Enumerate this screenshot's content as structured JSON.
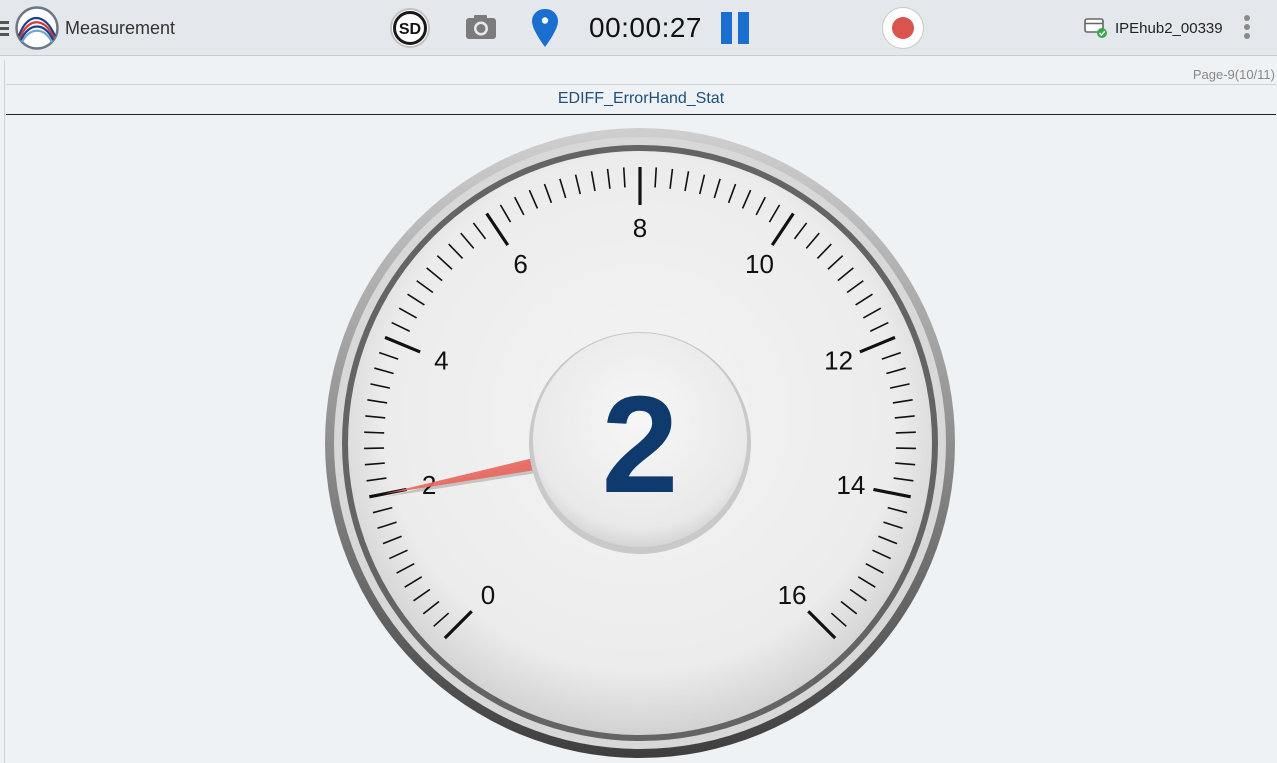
{
  "topbar": {
    "title": "Measurement",
    "sd_label": "SD",
    "timer": "00:00:27",
    "device_name": "IPEhub2_00339",
    "icons": {
      "menu": "menu-handle-icon",
      "logo": "app-logo-icon",
      "sd": "sd-card-icon",
      "camera": "camera-icon",
      "location": "location-pin-icon",
      "pause": "pause-icon",
      "record": "record-icon",
      "device": "device-connected-icon",
      "overflow": "more-vert-icon"
    },
    "colors": {
      "pause": "#1a6ed0",
      "location": "#1a6ed0",
      "record": "#d9534f"
    }
  },
  "page": {
    "indicator": "Page-9(10/11)",
    "gauge_name": "EDIFF_ErrorHand_Stat"
  },
  "gauge": {
    "value": 2,
    "value_label": "2",
    "min": 0,
    "max": 16,
    "major_tick_labels": [
      "0",
      "2",
      "4",
      "6",
      "8",
      "10",
      "12",
      "14",
      "16"
    ],
    "needle_color": "#e8685e",
    "value_color": "#0f3a6e"
  }
}
